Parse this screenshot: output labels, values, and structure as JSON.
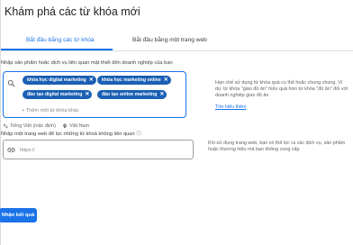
{
  "page": {
    "title": "Khám phá các từ khóa mới"
  },
  "tabs": [
    {
      "label": "Bắt đầu bằng các từ khóa",
      "active": true
    },
    {
      "label": "Bắt đầu bằng một trang web",
      "active": false
    }
  ],
  "keywords_section": {
    "label": "Nhập sản phẩm hoặc dịch vụ liên quan mật thiết đến doanh nghiệp của bạn",
    "chips": [
      "khóa học digital marketing",
      "khóa học marketing online",
      "đào tạo digital marketing",
      "đào tạo online marketing"
    ],
    "chip_remove_glyph": "✕",
    "add_more": "+ Thêm một từ khóa khác",
    "language": "Tiếng Việt (mặc định)",
    "location": "Việt Nam",
    "help_text": "Hạn chế sử dụng từ khóa quá cụ thể hoặc chung chung. Ví dụ: từ khóa \"giao đồ ăn\" hiệu quả hơn từ khóa \"đồ ăn\" đối với doanh nghiệp giao đồ ăn",
    "help_link": "Tìm hiểu thêm"
  },
  "url_section": {
    "label": "Nhập một trang web để lọc những từ khoá không liên quan",
    "optional_mark": "ⓘ",
    "placeholder": "https://",
    "help_text": "Khi sử dụng trang web, bạn có thể lọc ra các dịch vụ, sản phẩm hoặc thương hiệu mà bạn không cung cấp"
  },
  "submit_label": "Nhận kết quả",
  "colors": {
    "accent": "#1a73e8",
    "chip": "#1a5fb4"
  }
}
